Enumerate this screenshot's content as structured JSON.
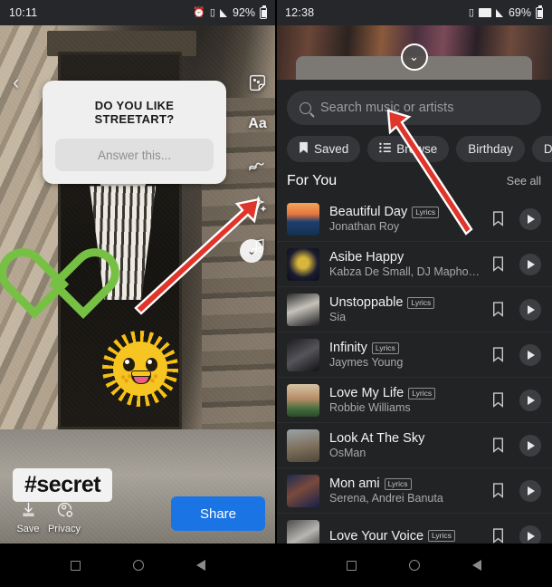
{
  "left": {
    "statusbar": {
      "time": "10:11",
      "battery": "92%",
      "icons": [
        "alarm-icon",
        "vibrate-icon",
        "signal-icon",
        "battery-icon"
      ]
    },
    "back_icon": "‹",
    "question_sticker": {
      "question": "DO YOU LIKE STREETART?",
      "answer_placeholder": "Answer this..."
    },
    "hashtag_sticker": "#secret",
    "tools": [
      {
        "name": "sticker-icon",
        "glyph": "☺"
      },
      {
        "name": "text-icon",
        "glyph": "Aa"
      },
      {
        "name": "draw-icon",
        "glyph": "≈"
      },
      {
        "name": "effects-icon",
        "glyph": "✨"
      },
      {
        "name": "music-icon",
        "glyph": "♫"
      }
    ],
    "collapse_icon": "⌄",
    "save_label": "Save",
    "privacy_label": "Privacy",
    "share_label": "Share",
    "share_color": "#1b74e4",
    "arrow_color": "#e0352b"
  },
  "right": {
    "statusbar": {
      "time": "12:38",
      "battery": "69%",
      "icons": [
        "vibrate-icon",
        "wifi-icon",
        "signal-icon",
        "battery-icon"
      ]
    },
    "collapse_icon": "⌄",
    "search": {
      "placeholder": "Search music or artists",
      "icon": "search-icon"
    },
    "chips": [
      {
        "label": "Saved",
        "icon": "bookmark-icon"
      },
      {
        "label": "Browse",
        "icon": "list-icon"
      },
      {
        "label": "Birthday",
        "icon": ""
      },
      {
        "label": "Date Nig",
        "icon": ""
      }
    ],
    "section": {
      "title": "For You",
      "see_all": "See all"
    },
    "songs": [
      {
        "title": "Beautiful Day",
        "lyrics": "Lyrics",
        "artist": "Jonathan Roy",
        "art": "linear-gradient(180deg,#f0a55c 0%,#e8763f 34%,#1d3f6e 58%,#13314f 100%)"
      },
      {
        "title": "Asibe Happy",
        "lyrics": "",
        "artist": "Kabza De Small, DJ Maphoris...",
        "art": "radial-gradient(circle at 50% 45%, #d8b53c 0 22%, #1a1c30 60%, #0c0d18 100%)"
      },
      {
        "title": "Unstoppable",
        "lyrics": "Lyrics",
        "artist": "Sia",
        "art": "linear-gradient(160deg,#2a2a2c 0%,#c6c2ba 45%,#1a1a1c 100%)"
      },
      {
        "title": "Infinity",
        "lyrics": "Lyrics",
        "artist": "Jaymes Young",
        "art": "linear-gradient(150deg,#1c1c1e 0%,#55545a 50%,#121214 100%)"
      },
      {
        "title": "Love My Life",
        "lyrics": "Lyrics",
        "artist": "Robbie Williams",
        "art": "linear-gradient(180deg,#d8c3a4 0%,#b58d68 45%,#3f6b3a 78%,#2c4a2a 100%)"
      },
      {
        "title": "Look At The Sky",
        "lyrics": "",
        "artist": "OsMan",
        "art": "linear-gradient(170deg,#9aa4a8 0%,#7d6f5c 55%,#4f4638 100%)"
      },
      {
        "title": "Mon ami",
        "lyrics": "Lyrics",
        "artist": "Serena, Andrei Banuta",
        "art": "linear-gradient(150deg,#1b2b52 0%,#7a4a3c 45%,#14204a 100%)"
      },
      {
        "title": "Love Your Voice",
        "lyrics": "Lyrics",
        "artist": "",
        "art": "linear-gradient(150deg,#4a4a4c 0%,#b8b6b2 50%,#2a2a2c 100%)"
      }
    ],
    "row_icons": {
      "bookmark": "bookmark-icon",
      "play": "play-icon"
    },
    "arrow_color": "#e0352b"
  },
  "navbar": {
    "recents": "recents-icon",
    "home": "home-icon",
    "back": "back-icon"
  }
}
